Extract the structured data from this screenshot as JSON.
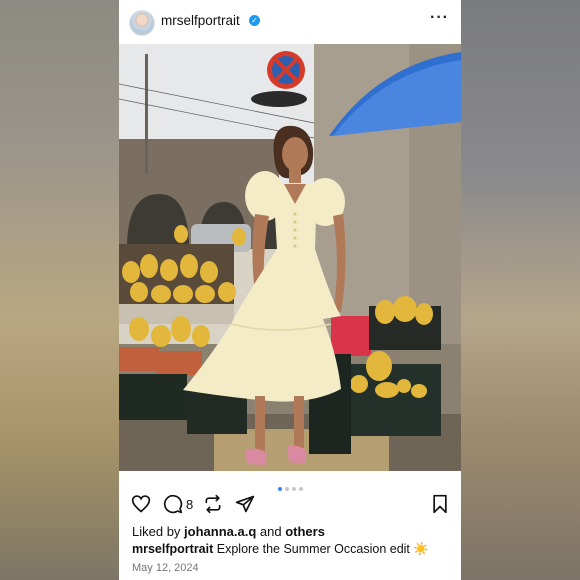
{
  "post": {
    "username": "mrselfportrait",
    "verified_badge": "✓",
    "more_icon": "more-dots-icon",
    "carousel": {
      "count": 4,
      "active_index": 0
    },
    "actions": {
      "comment_count": "8"
    },
    "likes": {
      "prefix": "Liked by ",
      "user": "johanna.a.q",
      "middle": " and ",
      "others": "others"
    },
    "caption": {
      "user": "mrselfportrait",
      "text": " Explore the Summer Occasion edit ☀️"
    },
    "date": "May 12, 2024"
  },
  "colors": {
    "verified": "#1d9bf0",
    "active_dot": "#3b82f6",
    "dress": "#f3ecc6"
  }
}
